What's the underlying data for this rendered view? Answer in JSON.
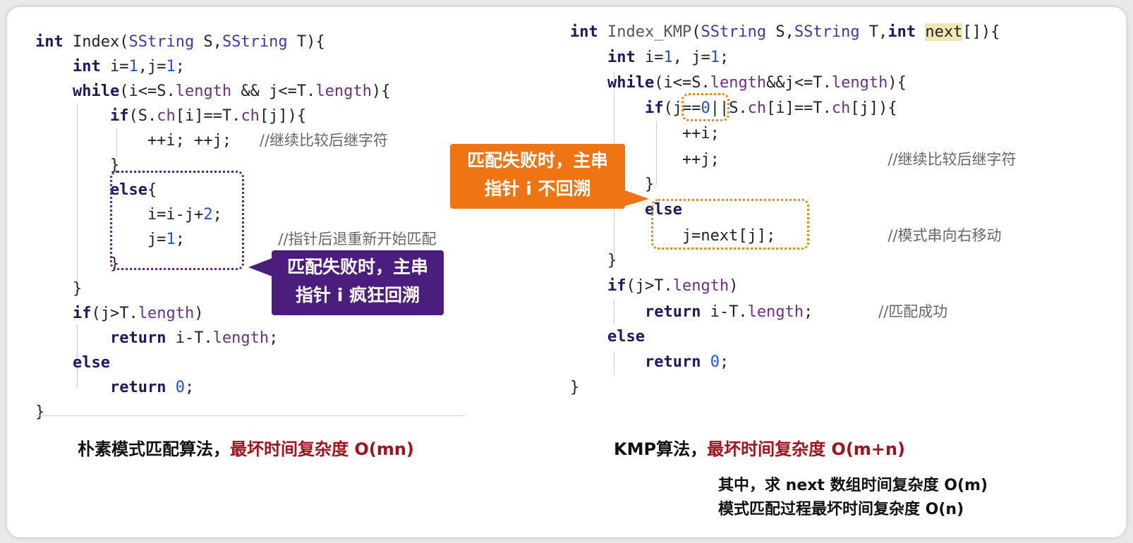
{
  "left_code": {
    "lines": [
      [
        [
          "kw",
          "int "
        ],
        [
          "t",
          "Index("
        ],
        [
          "ty",
          "SString"
        ],
        [
          "t",
          " S,"
        ],
        [
          "ty",
          "SString"
        ],
        [
          "t",
          " T){"
        ]
      ],
      [
        [
          "t",
          "    "
        ],
        [
          "kw",
          "int "
        ],
        [
          "t",
          "i="
        ],
        [
          "num",
          "1"
        ],
        [
          "t",
          ",j="
        ],
        [
          "num",
          "1"
        ],
        [
          "t",
          ";"
        ]
      ],
      [
        [
          "t",
          "    "
        ],
        [
          "kw",
          "while"
        ],
        [
          "t",
          "(i<=S."
        ],
        [
          "mem",
          "length"
        ],
        [
          "t",
          " && j<=T."
        ],
        [
          "mem",
          "length"
        ],
        [
          "t",
          "){"
        ]
      ],
      [
        [
          "t",
          "        "
        ],
        [
          "kw",
          "if"
        ],
        [
          "t",
          "(S."
        ],
        [
          "mem",
          "ch"
        ],
        [
          "t",
          "[i]==T."
        ],
        [
          "mem",
          "ch"
        ],
        [
          "t",
          "[j]){"
        ]
      ],
      [
        [
          "t",
          "            ++i; ++j;   "
        ],
        [
          "cm",
          "//继续比较后继字符"
        ]
      ],
      [
        [
          "t",
          "        }"
        ]
      ],
      [
        [
          "t",
          "        "
        ],
        [
          "kw",
          "else"
        ],
        [
          "t",
          "{"
        ]
      ],
      [
        [
          "t",
          "            i=i-j+"
        ],
        [
          "num",
          "2"
        ],
        [
          "t",
          ";"
        ]
      ],
      [
        [
          "t",
          "            j="
        ],
        [
          "num",
          "1"
        ],
        [
          "t",
          ";          "
        ],
        [
          "cm",
          "//指针后退重新开始匹配"
        ]
      ],
      [
        [
          "t",
          "        }"
        ]
      ],
      [
        [
          "t",
          "    }"
        ]
      ],
      [
        [
          "t",
          "    "
        ],
        [
          "kw",
          "if"
        ],
        [
          "t",
          "(j>T."
        ],
        [
          "mem",
          "length"
        ],
        [
          "t",
          ")"
        ]
      ],
      [
        [
          "t",
          "        "
        ],
        [
          "kw",
          "return"
        ],
        [
          "t",
          " i-T."
        ],
        [
          "mem",
          "length"
        ],
        [
          "t",
          ";"
        ]
      ],
      [
        [
          "t",
          "    "
        ],
        [
          "kw",
          "else"
        ]
      ],
      [
        [
          "t",
          "        "
        ],
        [
          "kw",
          "return "
        ],
        [
          "num",
          "0"
        ],
        [
          "t",
          ";"
        ]
      ],
      [
        [
          "t",
          "}"
        ]
      ]
    ]
  },
  "right_code": {
    "lines": [
      [
        [
          "kw",
          "int "
        ],
        [
          "gray",
          "Index_KMP"
        ],
        [
          "t",
          "("
        ],
        [
          "ty",
          "SString"
        ],
        [
          "t",
          " S,"
        ],
        [
          "ty",
          "SString"
        ],
        [
          "t",
          " T,"
        ],
        [
          "kw",
          "int "
        ],
        [
          "hl",
          "next"
        ],
        [
          "t",
          "[]){"
        ]
      ],
      [
        [
          "t",
          "    "
        ],
        [
          "kw",
          "int "
        ],
        [
          "t",
          "i="
        ],
        [
          "num",
          "1"
        ],
        [
          "t",
          ", j="
        ],
        [
          "num",
          "1"
        ],
        [
          "t",
          ";"
        ]
      ],
      [
        [
          "t",
          "    "
        ],
        [
          "kw",
          "while"
        ],
        [
          "t",
          "(i<=S."
        ],
        [
          "mem",
          "length"
        ],
        [
          "t",
          "&&j<=T."
        ],
        [
          "mem",
          "length"
        ],
        [
          "t",
          "){"
        ]
      ],
      [
        [
          "t",
          "        "
        ],
        [
          "kw",
          "if"
        ],
        [
          "t",
          "(j=="
        ],
        [
          "num",
          "0"
        ],
        [
          "t",
          "||S."
        ],
        [
          "mem",
          "ch"
        ],
        [
          "t",
          "[i]==T."
        ],
        [
          "mem",
          "ch"
        ],
        [
          "t",
          "[j]){"
        ]
      ],
      [
        [
          "t",
          "            ++i;"
        ]
      ],
      [
        [
          "t",
          "            ++j;                  "
        ],
        [
          "cm",
          "//继续比较后继字符"
        ]
      ],
      [
        [
          "t",
          "        }"
        ]
      ],
      [
        [
          "t",
          "        "
        ],
        [
          "kw",
          "else"
        ]
      ],
      [
        [
          "t",
          "            j=next[j];            "
        ],
        [
          "cm",
          "//模式串向右移动"
        ]
      ],
      [
        [
          "t",
          "    }"
        ]
      ],
      [
        [
          "t",
          "    "
        ],
        [
          "kw",
          "if"
        ],
        [
          "t",
          "(j>T."
        ],
        [
          "mem",
          "length"
        ],
        [
          "t",
          ")"
        ]
      ],
      [
        [
          "t",
          "        "
        ],
        [
          "kw",
          "return"
        ],
        [
          "t",
          " i-T."
        ],
        [
          "mem",
          "length"
        ],
        [
          "t",
          ";       "
        ],
        [
          "cm",
          "//匹配成功"
        ]
      ],
      [
        [
          "t",
          "    "
        ],
        [
          "kw",
          "else"
        ]
      ],
      [
        [
          "t",
          "        "
        ],
        [
          "kw",
          "return "
        ],
        [
          "num",
          "0"
        ],
        [
          "t",
          ";"
        ]
      ],
      [
        [
          "t",
          "}"
        ]
      ]
    ]
  },
  "callouts": {
    "left": {
      "line1": "匹配失败时，主串",
      "line2": "指针 i 疯狂回溯"
    },
    "right": {
      "line1": "匹配失败时，主串",
      "line2": "指针 i 不回溯"
    }
  },
  "captions": {
    "left_prefix": "朴素模式匹配算法，",
    "left_red": "最坏时间复杂度 O(mn)",
    "right_prefix": "KMP算法，",
    "right_red": "最坏时间复杂度 O(m+n)"
  },
  "notes": {
    "line1": "其中，求 next 数组时间复杂度 O(m)",
    "line2": "模式匹配过程最坏时间复杂度 O(n)"
  },
  "colors": {
    "purple": "#4b1e7e",
    "orange": "#ef7413",
    "red": "#a1121c"
  }
}
